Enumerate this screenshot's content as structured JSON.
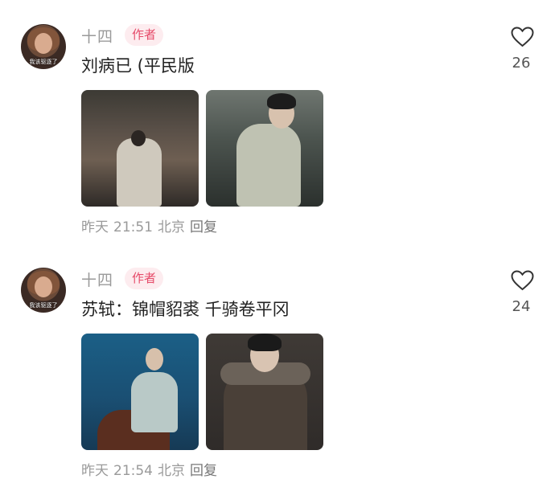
{
  "comments": [
    {
      "username": "十四",
      "badge": "作者",
      "avatar_caption": "我该驱逐了",
      "text": "刘病已 (平民版",
      "like_count": "26",
      "date": "昨天",
      "time": "21:51",
      "location": "北京",
      "reply_label": "回复",
      "images": [
        "street-scene-photo",
        "seated-figure-photo"
      ]
    },
    {
      "username": "十四",
      "badge": "作者",
      "avatar_caption": "我该驱逐了",
      "text": "苏轼：锦帽貂裘 千骑卷平冈",
      "like_count": "24",
      "date": "昨天",
      "time": "21:54",
      "location": "北京",
      "reply_label": "回复",
      "images": [
        "horse-rider-photo",
        "cloaked-figure-photo"
      ]
    }
  ],
  "colors": {
    "badge_bg": "#fdecef",
    "badge_text": "#e64b6a",
    "meta": "#9a9a9a"
  }
}
